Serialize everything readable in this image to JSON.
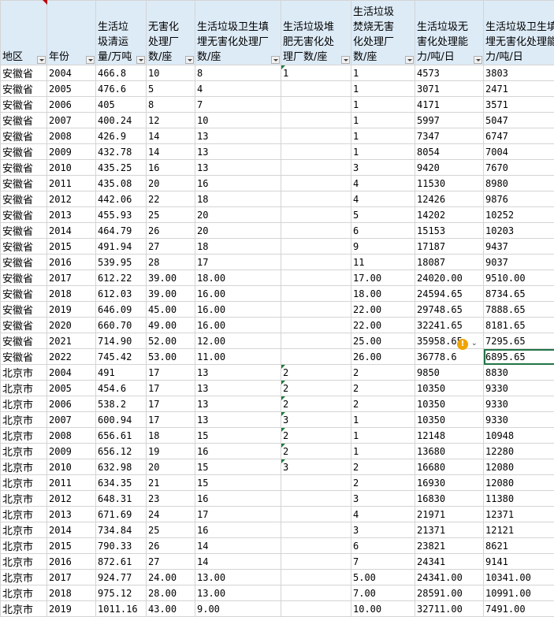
{
  "headers": [
    "地区",
    "年份",
    "生活垃圾清运量/万吨",
    "无害化处理厂数/座",
    "生活垃圾卫生填埋无害化处理厂数/座",
    "生活垃圾堆肥无害化处理厂数/座",
    "生活垃圾焚烧无害化处理厂数/座",
    "生活垃圾无害化处理能力/吨/日",
    "生活垃圾卫生填埋无害化处理能力/吨/日"
  ],
  "rows": [
    [
      "安徽省",
      "2004",
      "466.8",
      "10",
      "8",
      "1",
      "1",
      "4573",
      "3803"
    ],
    [
      "安徽省",
      "2005",
      "476.6",
      "5",
      "4",
      "",
      "1",
      "3071",
      "2471"
    ],
    [
      "安徽省",
      "2006",
      "405",
      "8",
      "7",
      "",
      "1",
      "4171",
      "3571"
    ],
    [
      "安徽省",
      "2007",
      "400.24",
      "12",
      "10",
      "",
      "1",
      "5997",
      "5047"
    ],
    [
      "安徽省",
      "2008",
      "426.9",
      "14",
      "13",
      "",
      "1",
      "7347",
      "6747"
    ],
    [
      "安徽省",
      "2009",
      "432.78",
      "14",
      "13",
      "",
      "1",
      "8054",
      "7004"
    ],
    [
      "安徽省",
      "2010",
      "435.25",
      "16",
      "13",
      "",
      "3",
      "9420",
      "7670"
    ],
    [
      "安徽省",
      "2011",
      "435.08",
      "20",
      "16",
      "",
      "4",
      "11530",
      "8980"
    ],
    [
      "安徽省",
      "2012",
      "442.06",
      "22",
      "18",
      "",
      "4",
      "12426",
      "9876"
    ],
    [
      "安徽省",
      "2013",
      "455.93",
      "25",
      "20",
      "",
      "5",
      "14202",
      "10252"
    ],
    [
      "安徽省",
      "2014",
      "464.79",
      "26",
      "20",
      "",
      "6",
      "15153",
      "10203"
    ],
    [
      "安徽省",
      "2015",
      "491.94",
      "27",
      "18",
      "",
      "9",
      "17187",
      "9437"
    ],
    [
      "安徽省",
      "2016",
      "539.95",
      "28",
      "17",
      "",
      "11",
      "18087",
      "9037"
    ],
    [
      "安徽省",
      "2017",
      "612.22",
      "39.00",
      "18.00",
      "",
      "17.00",
      "24020.00",
      "9510.00"
    ],
    [
      "安徽省",
      "2018",
      "612.03",
      "39.00",
      "16.00",
      "",
      "18.00",
      "24594.65",
      "8734.65"
    ],
    [
      "安徽省",
      "2019",
      "646.09",
      "45.00",
      "16.00",
      "",
      "22.00",
      "29748.65",
      "7888.65"
    ],
    [
      "安徽省",
      "2020",
      "660.70",
      "49.00",
      "16.00",
      "",
      "22.00",
      "32241.65",
      "8181.65"
    ],
    [
      "安徽省",
      "2021",
      "714.90",
      "52.00",
      "12.00",
      "",
      "25.00",
      "35958.65",
      "7295.65"
    ],
    [
      "安徽省",
      "2022",
      "745.42",
      "53.00",
      "11.00",
      "",
      "26.00",
      "36778.6",
      "6895.65"
    ],
    [
      "北京市",
      "2004",
      "491",
      "17",
      "13",
      "2",
      "2",
      "9850",
      "8830"
    ],
    [
      "北京市",
      "2005",
      "454.6",
      "17",
      "13",
      "2",
      "2",
      "10350",
      "9330"
    ],
    [
      "北京市",
      "2006",
      "538.2",
      "17",
      "13",
      "2",
      "2",
      "10350",
      "9330"
    ],
    [
      "北京市",
      "2007",
      "600.94",
      "17",
      "13",
      "3",
      "1",
      "10350",
      "9330"
    ],
    [
      "北京市",
      "2008",
      "656.61",
      "18",
      "15",
      "2",
      "1",
      "12148",
      "10948"
    ],
    [
      "北京市",
      "2009",
      "656.12",
      "19",
      "16",
      "2",
      "1",
      "13680",
      "12280"
    ],
    [
      "北京市",
      "2010",
      "632.98",
      "20",
      "15",
      "3",
      "2",
      "16680",
      "12080"
    ],
    [
      "北京市",
      "2011",
      "634.35",
      "21",
      "15",
      "",
      "2",
      "16930",
      "12080"
    ],
    [
      "北京市",
      "2012",
      "648.31",
      "23",
      "16",
      "",
      "3",
      "16830",
      "11380"
    ],
    [
      "北京市",
      "2013",
      "671.69",
      "24",
      "17",
      "",
      "4",
      "21971",
      "12371"
    ],
    [
      "北京市",
      "2014",
      "734.84",
      "25",
      "16",
      "",
      "3",
      "21371",
      "12121"
    ],
    [
      "北京市",
      "2015",
      "790.33",
      "26",
      "14",
      "",
      "6",
      "23821",
      "8621"
    ],
    [
      "北京市",
      "2016",
      "872.61",
      "27",
      "14",
      "",
      "7",
      "24341",
      "9141"
    ],
    [
      "北京市",
      "2017",
      "924.77",
      "24.00",
      "13.00",
      "",
      "5.00",
      "24341.00",
      "10341.00"
    ],
    [
      "北京市",
      "2018",
      "975.12",
      "28.00",
      "13.00",
      "",
      "7.00",
      "28591.00",
      "10991.00"
    ],
    [
      "北京市",
      "2019",
      "1011.16",
      "43.00",
      "9.00",
      "",
      "10.00",
      "32711.00",
      "7491.00"
    ]
  ],
  "warning_icon": "!"
}
